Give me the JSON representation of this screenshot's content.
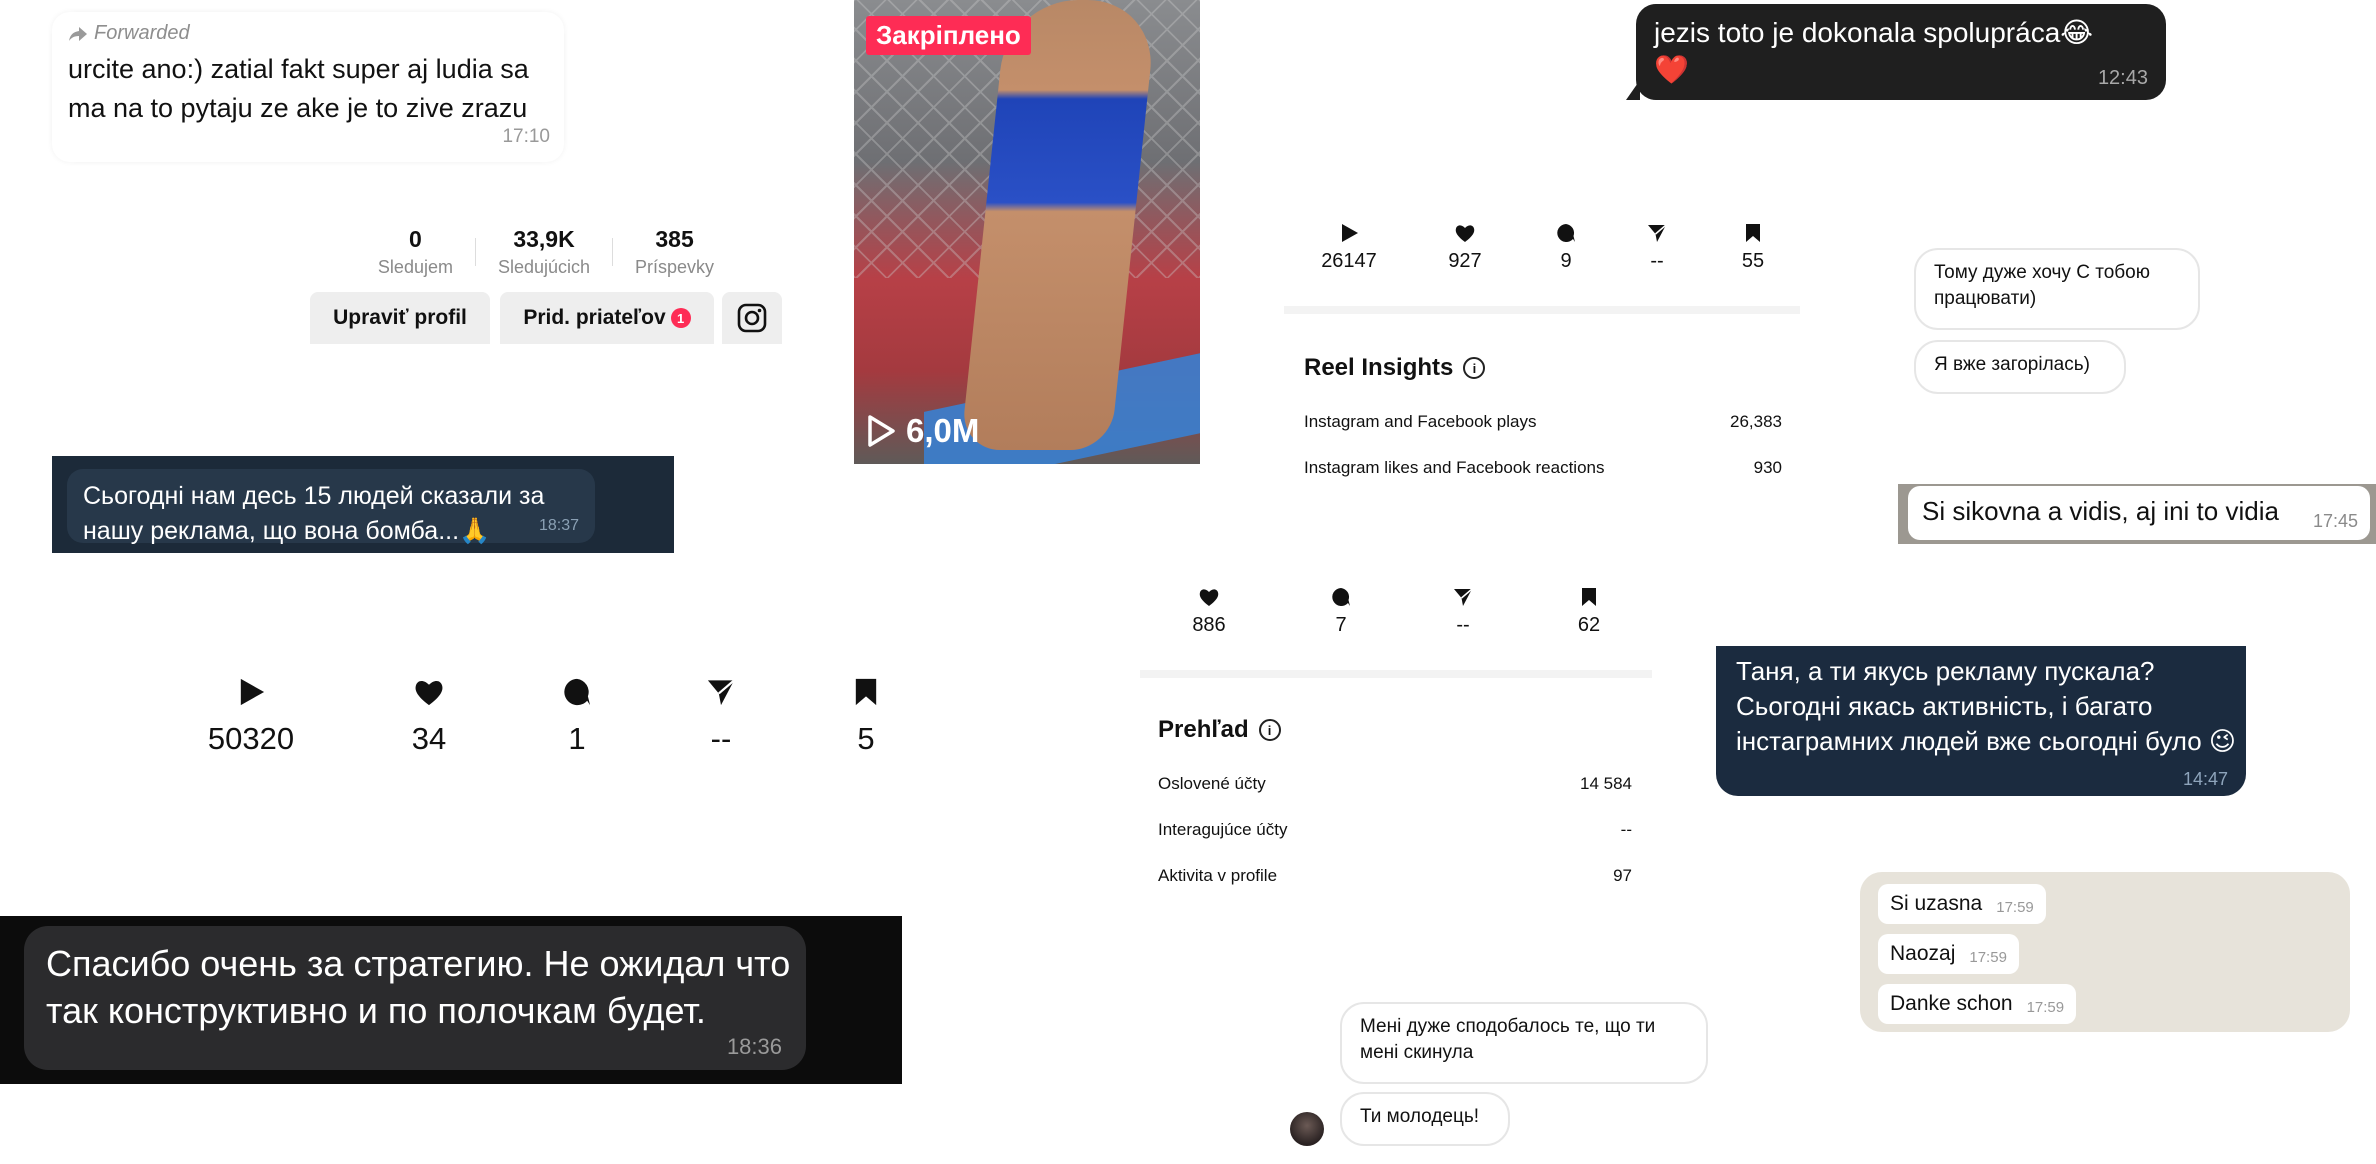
{
  "forwarded": {
    "label": "Forwarded",
    "text": "urcite ano:) zatial fakt super aj ludia sa ma na to pytaju ze ake je to zive zrazu",
    "time": "17:10"
  },
  "profile": {
    "stats": [
      {
        "num": "0",
        "label": "Sledujem"
      },
      {
        "num": "33,9K",
        "label": "Sledujúcich"
      },
      {
        "num": "385",
        "label": "Príspevky"
      }
    ],
    "edit_button": "Upraviť profil",
    "add_friends_button": "Prid. priateľov",
    "add_friends_badge": "1",
    "instagram_icon": "instagram-icon"
  },
  "tg_blue": {
    "text": "Сьогодні нам десь 15 людей сказали за нашу реклама, що вона бомба...🙏",
    "time": "18:37"
  },
  "video": {
    "pinned": "Закріплено",
    "views": "6,0M"
  },
  "dark_bubble": {
    "text_line1": "jezis toto je dokonala spolupráca😂",
    "text_line2": "❤️",
    "time": "12:43"
  },
  "reel_metrics": [
    {
      "icon": "play-icon",
      "value": "26147"
    },
    {
      "icon": "heart-icon",
      "value": "927"
    },
    {
      "icon": "comment-icon",
      "value": "9"
    },
    {
      "icon": "share-icon",
      "value": "--"
    },
    {
      "icon": "bookmark-icon",
      "value": "55"
    }
  ],
  "reel_insights": {
    "title": "Reel Insights",
    "rows": [
      {
        "label": "Instagram and Facebook plays",
        "value": "26,383"
      },
      {
        "label": "Instagram likes and Facebook reactions",
        "value": "930"
      }
    ]
  },
  "ig_dm_right": {
    "msg1": "Тому дуже хочу С тобою працювати)",
    "msg2": "Я вже загорілась)"
  },
  "wa_one": {
    "text": "Si sikovna a vidis, aj ini to vidia",
    "time": "17:45"
  },
  "mid_metrics": [
    {
      "icon": "heart-icon",
      "value": "886"
    },
    {
      "icon": "comment-icon",
      "value": "7"
    },
    {
      "icon": "share-icon",
      "value": "--"
    },
    {
      "icon": "bookmark-icon",
      "value": "62"
    }
  ],
  "prehlad": {
    "title": "Prehľad",
    "rows": [
      {
        "label": "Oslovené účty",
        "value": "14 584"
      },
      {
        "label": "Interagujúce účty",
        "value": "--"
      },
      {
        "label": "Aktivita v profile",
        "value": "97"
      }
    ]
  },
  "big_metrics": [
    {
      "icon": "play-icon",
      "value": "50320"
    },
    {
      "icon": "heart-icon",
      "value": "34"
    },
    {
      "icon": "comment-icon",
      "value": "1"
    },
    {
      "icon": "share-icon",
      "value": "--"
    },
    {
      "icon": "bookmark-icon",
      "value": "5"
    }
  ],
  "tg_navy": {
    "text": "Таня, а ти якусь рекламу пускала? Сьогодні якась активність, і багато інстаграмних людей вже сьогодні було 😉",
    "time": "14:47"
  },
  "tg_black": {
    "text": "Спасибо очень за стратегию. Не ожидал что так конструктивно и по полочкам будет.",
    "time": "18:36"
  },
  "wa_beige": {
    "messages": [
      {
        "text": "Si uzasna",
        "time": "17:59"
      },
      {
        "text": "Naozaj",
        "time": "17:59"
      },
      {
        "text": "Danke schon",
        "time": "17:59"
      }
    ]
  },
  "ig_dm_bottom": {
    "msg1": "Мені дуже сподобалось те, що ти мені скинула",
    "msg2": "Ти молодець!"
  }
}
